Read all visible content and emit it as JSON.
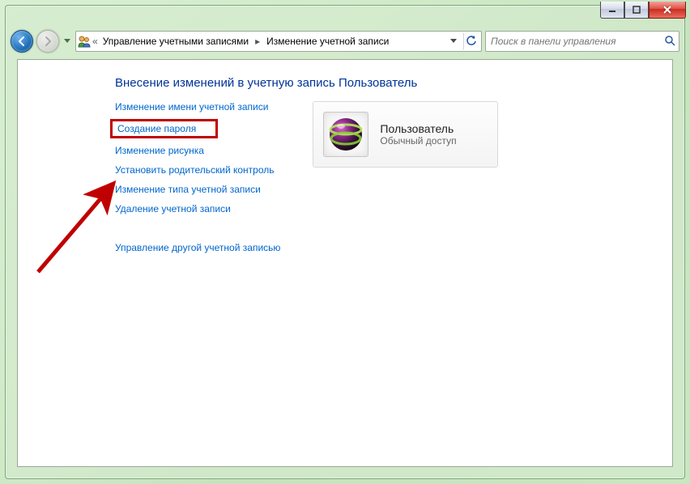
{
  "breadcrumb": {
    "truncated_indicator": "«",
    "items": [
      "Управление учетными записями",
      "Изменение учетной записи"
    ]
  },
  "search": {
    "placeholder": "Поиск в панели управления"
  },
  "page": {
    "heading": "Внесение изменений в учетную запись Пользователь"
  },
  "options": {
    "change_name": "Изменение имени учетной записи",
    "create_password": "Создание пароля",
    "change_picture": "Изменение рисунка",
    "parental": "Установить родительский контроль",
    "change_type": "Изменение типа учетной записи",
    "delete_account": "Удаление учетной записи",
    "manage_other": "Управление другой учетной записью"
  },
  "user_card": {
    "name": "Пользователь",
    "role": "Обычный доступ"
  }
}
